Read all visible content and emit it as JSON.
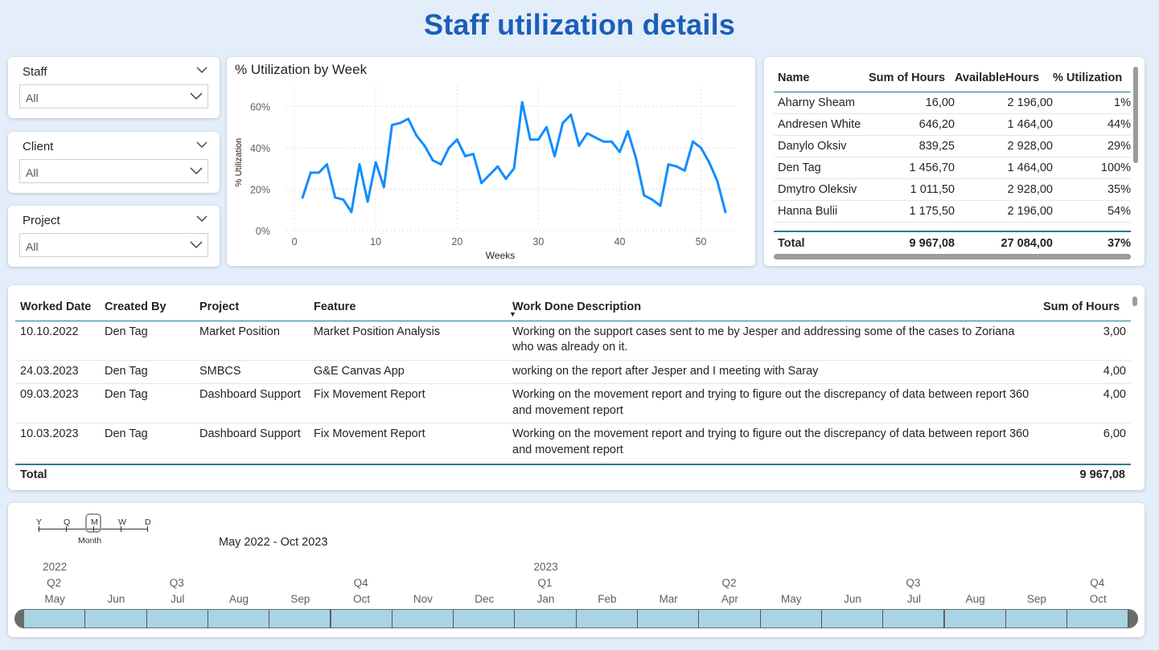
{
  "title": "Staff utilization details",
  "slicers": [
    {
      "label": "Staff",
      "value": "All"
    },
    {
      "label": "Client",
      "value": "All"
    },
    {
      "label": "Project",
      "value": "All"
    }
  ],
  "chart": {
    "title": "% Utilization by Week"
  },
  "chart_data": {
    "type": "line",
    "title": "% Utilization by Week",
    "xlabel": "Weeks",
    "ylabel": "% Utilization",
    "ylim": [
      0,
      66
    ],
    "xlim": [
      -1,
      54
    ],
    "y_ticks": [
      "0%",
      "20%",
      "40%",
      "60%"
    ],
    "x_ticks": [
      "0",
      "10",
      "20",
      "30",
      "40",
      "50"
    ],
    "grid": true,
    "color": "#118dff",
    "series": [
      {
        "x": [
          1,
          2,
          3,
          4,
          5,
          6,
          7,
          8,
          9,
          10,
          11,
          12,
          13,
          14,
          15,
          16,
          17,
          18,
          19,
          20,
          21,
          22,
          23,
          24,
          25,
          26,
          27,
          28,
          29,
          30,
          31,
          32,
          33,
          34,
          35,
          36,
          37,
          38,
          39,
          40,
          41,
          42,
          43,
          44,
          45,
          46,
          47,
          48,
          49,
          50,
          51,
          52,
          53
        ],
        "values": [
          16,
          28,
          28,
          32,
          16,
          15,
          9,
          32,
          14,
          33,
          21,
          51,
          52,
          54,
          46,
          41,
          34,
          32,
          40,
          44,
          36,
          37,
          23,
          27,
          31,
          25,
          30,
          62,
          44,
          44,
          50,
          36,
          52,
          56,
          41,
          47,
          45,
          43,
          43,
          38,
          48,
          35,
          17,
          15,
          12,
          32,
          31,
          29,
          43,
          40,
          33,
          24,
          9
        ]
      }
    ]
  },
  "staff_table": {
    "headers": [
      "Name",
      "Sum of Hours",
      "AvailableHours",
      "% Utilization"
    ],
    "rows": [
      [
        "Aharny Sheam",
        "16,00",
        "2 196,00",
        "1%"
      ],
      [
        "Andresen White",
        "646,20",
        "1 464,00",
        "44%"
      ],
      [
        "Danylo Oksiv",
        "839,25",
        "2 928,00",
        "29%"
      ],
      [
        "Den Tag",
        "1 456,70",
        "1 464,00",
        "100%"
      ],
      [
        "Dmytro Oleksiv",
        "1 011,50",
        "2 928,00",
        "35%"
      ],
      [
        "Hanna Bulii",
        "1 175,50",
        "2 196,00",
        "54%"
      ]
    ],
    "total": [
      "Total",
      "9 967,08",
      "27 084,00",
      "37%"
    ]
  },
  "work_table": {
    "headers": [
      "Worked Date",
      "Created By",
      "Project",
      "Feature",
      "Work Done Description",
      "Sum of Hours"
    ],
    "rows": [
      [
        "10.10.2022",
        "Den Tag",
        "Market Position",
        "Market Position Analysis",
        "Working on the support cases sent to me by Jesper and addressing some of the cases to Zoriana who was already on it.",
        "3,00"
      ],
      [
        "24.03.2023",
        "Den Tag",
        "SMBCS",
        "G&E Canvas App",
        "working on the report after Jesper and I meeting with Saray",
        "4,00"
      ],
      [
        "09.03.2023",
        "Den Tag",
        "Dashboard Support",
        "Fix Movement Report",
        "Working on the movement report and trying to figure out the discrepancy of data between report 360 and movement report",
        "4,00"
      ],
      [
        "10.03.2023",
        "Den Tag",
        "Dashboard Support",
        "Fix Movement Report",
        "Working on the movement report and trying to figure out the discrepancy of data between report 360 and movement report",
        "6,00"
      ]
    ],
    "total_label": "Total",
    "total_value": "9 967,08"
  },
  "timeline": {
    "levels": [
      "Y",
      "Q",
      "M",
      "W",
      "D"
    ],
    "level_name": "Month",
    "range": "May 2022 - Oct 2023",
    "years": [
      "2022",
      "2023"
    ],
    "quarters": [
      "Q2",
      "Q3",
      "Q4",
      "Q1",
      "Q2",
      "Q3",
      "Q4"
    ],
    "months": [
      "May",
      "Jun",
      "Jul",
      "Aug",
      "Sep",
      "Oct",
      "Nov",
      "Dec",
      "Jan",
      "Feb",
      "Mar",
      "Apr",
      "May",
      "Jun",
      "Jul",
      "Aug",
      "Sep",
      "Oct"
    ]
  }
}
